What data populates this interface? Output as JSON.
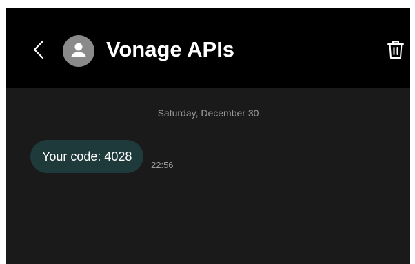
{
  "header": {
    "back_icon": "chevron-left-icon",
    "avatar_icon": "person-icon",
    "contact_name": "Vonage APIs",
    "delete_icon": "trash-icon"
  },
  "conversation": {
    "date_separator": "Saturday, December 30",
    "messages": [
      {
        "direction": "incoming",
        "text": "Your code: 4028",
        "time": "22:56"
      }
    ]
  },
  "colors": {
    "header_bg": "#000000",
    "conversation_bg": "#1a1a1a",
    "bubble_bg": "#1f3a3a",
    "avatar_bg": "#8a8a8a",
    "text_primary": "#ffffff",
    "text_secondary": "#9a9a9a"
  }
}
